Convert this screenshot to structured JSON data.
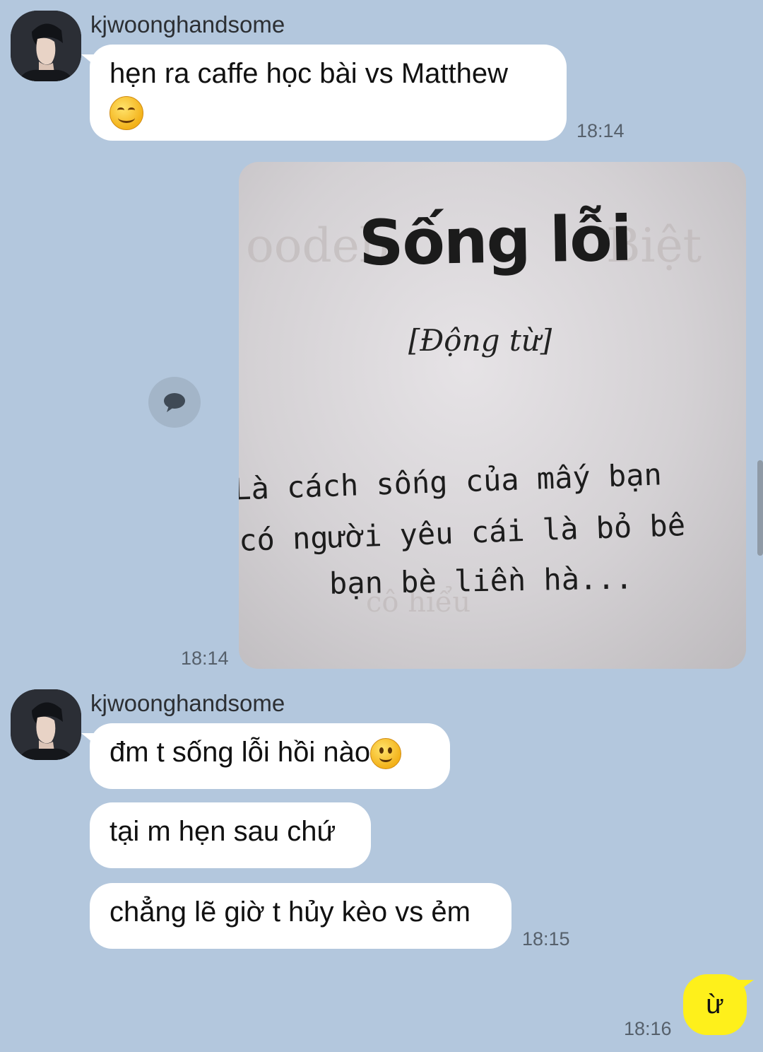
{
  "chat": {
    "messages": [
      {
        "sender": "kjwoonghandsome",
        "text": "hẹn ra caffe học bài vs Matthew",
        "time": "18:14"
      },
      {
        "type": "photo",
        "time": "18:14",
        "photo_text": {
          "title": "Sống lỗi",
          "pos": "[Động từ]",
          "lines": [
            "Là cách sống của mấy bạn",
            "có người yêu cái là bỏ bê",
            "bạn bè liền hà..."
          ]
        }
      },
      {
        "sender": "kjwoonghandsome",
        "text": "đm t sống lỗi hồi nào"
      },
      {
        "text": "tại m hẹn sau chứ"
      },
      {
        "text": "chẳng lẽ giờ t hủy kèo vs ẻm",
        "time": "18:15"
      },
      {
        "from_me": true,
        "text": "ừ",
        "time": "18:16"
      }
    ]
  },
  "colors": {
    "background": "#b3c7dd",
    "bubble_other": "#ffffff",
    "bubble_me": "#fef01b"
  },
  "icons": {
    "comment": "speech-bubble-icon",
    "emoji_1": "smiling-face-icon",
    "emoji_2": "slightly-smiling-face-icon"
  }
}
